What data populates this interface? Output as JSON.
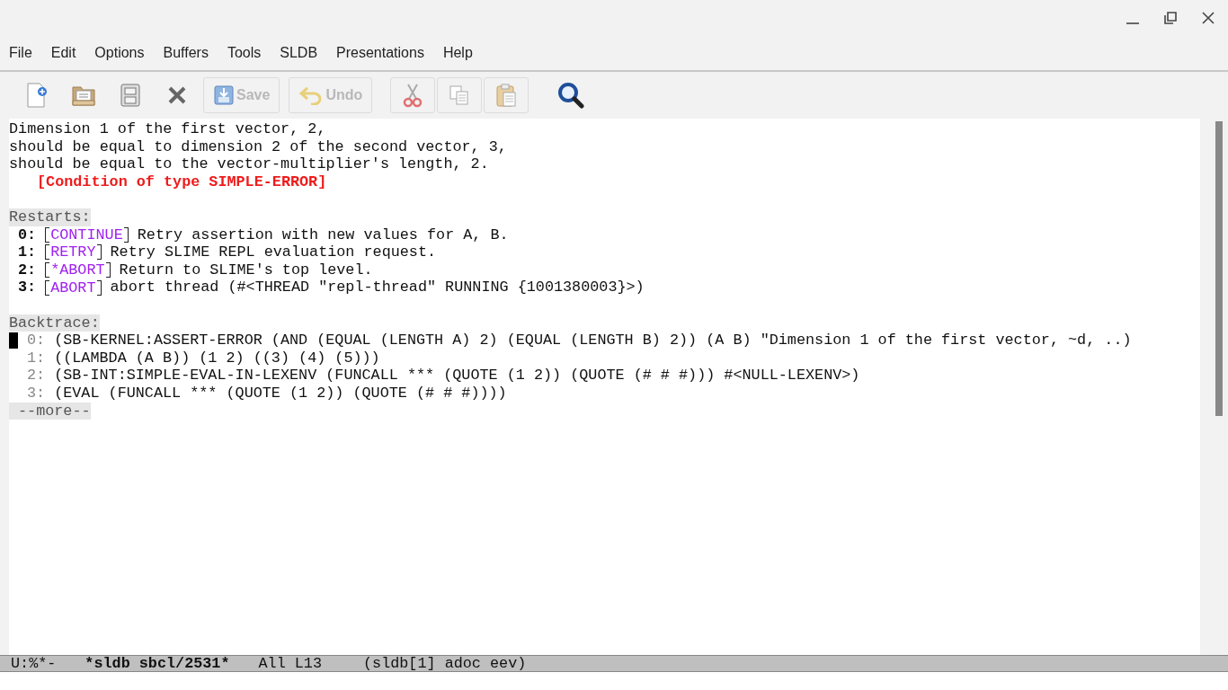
{
  "menu": [
    "File",
    "Edit",
    "Options",
    "Buffers",
    "Tools",
    "SLDB",
    "Presentations",
    "Help"
  ],
  "toolbar": [
    {
      "kind": "icon",
      "disabled": false
    },
    {
      "kind": "icon",
      "disabled": false
    },
    {
      "kind": "icon",
      "disabled": false
    },
    {
      "kind": "icon",
      "disabled": false
    },
    {
      "kind": "labeled",
      "label": "Save",
      "disabled": true
    },
    {
      "kind": "labeled",
      "label": "Undo",
      "disabled": true
    },
    {
      "kind": "icon",
      "disabled": true
    },
    {
      "kind": "icon",
      "disabled": true
    },
    {
      "kind": "icon",
      "disabled": true
    },
    {
      "kind": "icon",
      "disabled": false
    }
  ],
  "message": [
    "Dimension 1 of the first vector, 2,",
    "should be equal to dimension 2 of the second vector, 3,",
    "should be equal to the vector-multiplier's length, 2."
  ],
  "condition": "[Condition of type SIMPLE-ERROR]",
  "restarts_heading": "Restarts:",
  "restarts": [
    {
      "number": "0:",
      "option": "CONTINUE",
      "description": "Retry assertion with new values for A, B."
    },
    {
      "number": "1:",
      "option": "RETRY",
      "description": "Retry SLIME REPL evaluation request."
    },
    {
      "number": "2:",
      "option": "*ABORT",
      "description": "Return to SLIME's top level."
    },
    {
      "number": "3:",
      "option": "ABORT",
      "description": "abort thread (#<THREAD \"repl-thread\" RUNNING {1001380003}>)"
    }
  ],
  "backtrace_heading": "Backtrace:",
  "backtrace": [
    {
      "index": "0:",
      "cursor": true,
      "text": "(SB-KERNEL:ASSERT-ERROR (AND (EQUAL (LENGTH A) 2) (EQUAL (LENGTH B) 2)) (A B) \"Dimension 1 of the first vector, ~d, ..)"
    },
    {
      "index": "1:",
      "cursor": false,
      "text": "((LAMBDA (A B)) (1 2) ((3) (4) (5)))"
    },
    {
      "index": "2:",
      "cursor": false,
      "text": "(SB-INT:SIMPLE-EVAL-IN-LEXENV (FUNCALL *** (QUOTE (1 2)) (QUOTE (# # #))) #<NULL-LEXENV>)"
    },
    {
      "index": "3:",
      "cursor": false,
      "text": "(EVAL (FUNCALL *** (QUOTE (1 2)) (QUOTE (# # #))))"
    }
  ],
  "more": "--more--",
  "mode_line": {
    "state": "U:%*-",
    "buffer": "*sldb sbcl/2531*",
    "position": "All L13",
    "modes": "(sldb[1] adoc eev)"
  }
}
